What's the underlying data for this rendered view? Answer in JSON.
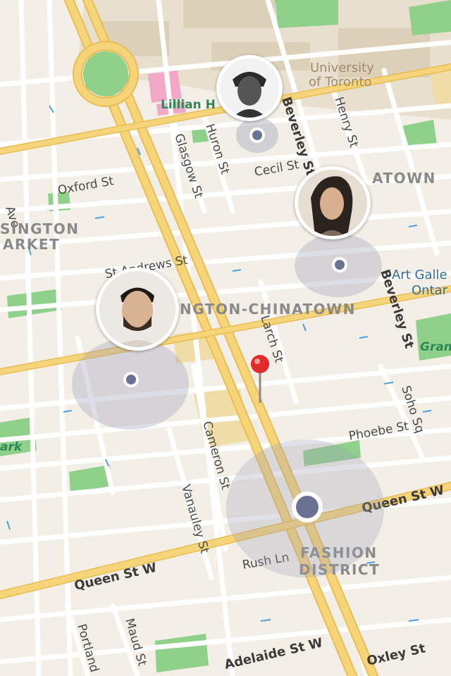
{
  "map": {
    "streets": {
      "beverley_st_top": "Beverley St",
      "beverley_st_right": "Beverley St",
      "henry_st": "Henry St",
      "huron_st": "Huron St",
      "glasgow_st": "Glasgow St",
      "cecil_st": "Cecil St",
      "oxford_st": "Oxford St",
      "st_andrews_st": "St Andrews St",
      "larch_st": "Larch St",
      "cameron_st": "Cameron St",
      "vanauley_st": "Vanauley St",
      "soho_sq": "Soho Sq",
      "phoebe_st": "Phoebe St",
      "queen_st_w_right": "Queen St W",
      "queen_st_w_left": "Queen St W",
      "rush_ln": "Rush Ln",
      "portland": "Portland",
      "maud_st": "Maud St",
      "adelaide_st_w": "Adelaide St W",
      "oxley_st": "Oxley St",
      "ave": "Ave"
    },
    "districts": {
      "kensington_1": "SINGTON",
      "kensington_2": "ARKET",
      "chinatown": "NGTON-CHINATOWN",
      "chinatown_top": "ATOWN",
      "fashion_1": "FASHION",
      "fashion_2": "DISTRICT"
    },
    "pois": {
      "university_1": "University",
      "university_2": "of Toronto",
      "lillian": "Lillian H",
      "art_gallery_1": "Art Galle",
      "art_gallery_2": "Ontar",
      "grange": "Gran",
      "park": "ark"
    },
    "colors": {
      "land": "#f4efe6",
      "road_major": "#f6d57a",
      "road_major_edge": "#e8bd55",
      "road_minor": "#ffffff",
      "park": "#8fd08a",
      "accuracy": "#c9c9cc",
      "location_dot": "#6a7294",
      "pin": "#e02b2b"
    }
  },
  "people": [
    {
      "name": "friend-top",
      "icon": "person-avatar"
    },
    {
      "name": "friend-right",
      "icon": "person-avatar"
    },
    {
      "name": "friend-left",
      "icon": "person-avatar"
    }
  ],
  "pin": {
    "icon": "map-pin-icon"
  }
}
